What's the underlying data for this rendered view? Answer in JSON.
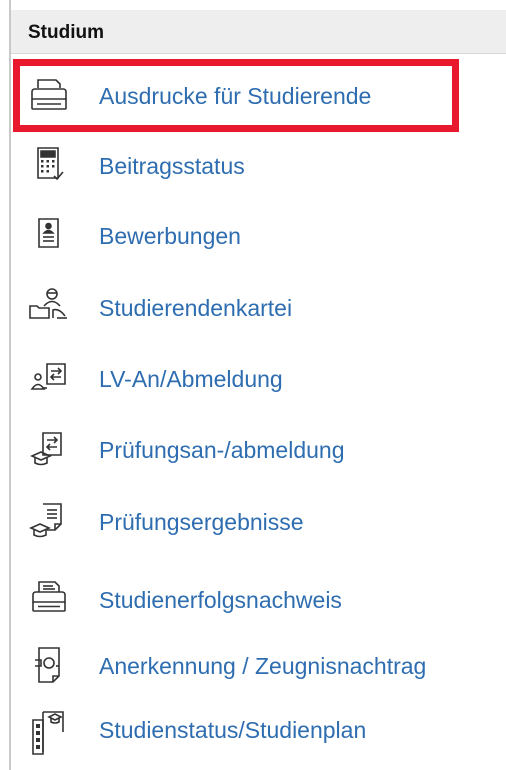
{
  "menu": {
    "title": "Studium",
    "highlight_color": "#e8192c",
    "link_color": "#2e6db0",
    "items": [
      {
        "label": "Ausdrucke für Studierende",
        "icon": "printer-icon"
      },
      {
        "label": "Beitragsstatus",
        "icon": "calculator-icon"
      },
      {
        "label": "Bewerbungen",
        "icon": "application-form-icon"
      },
      {
        "label": "Studierendenkartei",
        "icon": "student-folder-icon"
      },
      {
        "label": "LV-An/Abmeldung",
        "icon": "course-registration-icon"
      },
      {
        "label": "Prüfungsan-/abmeldung",
        "icon": "exam-registration-icon"
      },
      {
        "label": "Prüfungsergebnisse",
        "icon": "exam-results-icon"
      },
      {
        "label": "Studienerfolgsnachweis",
        "icon": "success-certificate-printer-icon"
      },
      {
        "label": "Anerkennung / Zeugnisnachtrag",
        "icon": "recognition-document-icon"
      },
      {
        "label": "Studienstatus/Studienplan",
        "icon": "study-plan-icon"
      }
    ]
  }
}
